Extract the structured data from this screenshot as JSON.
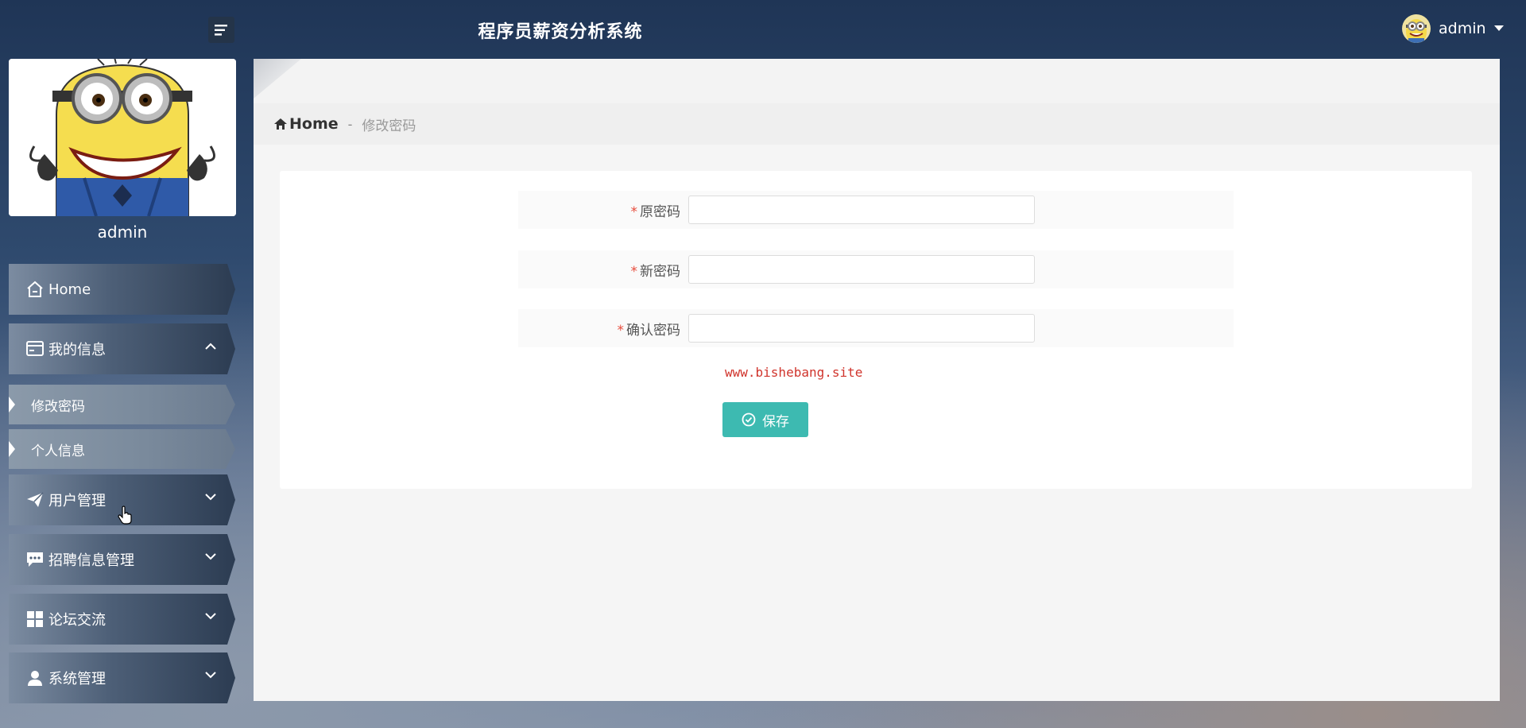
{
  "header": {
    "title": "程序员薪资分析系统",
    "username": "admin",
    "menu_toggle_icon": "hamburger-icon",
    "caret_icon": "caret-down-icon"
  },
  "profile": {
    "name": "admin",
    "image": "minion-avatar"
  },
  "sidebar": {
    "items": [
      {
        "label": "Home",
        "icon": "home-icon"
      },
      {
        "label": "我的信息",
        "icon": "id-card-icon",
        "expanded": true,
        "children": [
          {
            "label": "修改密码",
            "active": true
          },
          {
            "label": "个人信息"
          }
        ]
      },
      {
        "label": "用户管理",
        "icon": "paper-plane-icon"
      },
      {
        "label": "招聘信息管理",
        "icon": "comment-icon"
      },
      {
        "label": "论坛交流",
        "icon": "grid-icon"
      },
      {
        "label": "系统管理",
        "icon": "user-icon"
      }
    ]
  },
  "breadcrumb": {
    "home": "Home",
    "separator": "-",
    "current": "修改密码"
  },
  "form": {
    "required_mark": "*",
    "fields": [
      {
        "label": "原密码",
        "value": ""
      },
      {
        "label": "新密码",
        "value": ""
      },
      {
        "label": "确认密码",
        "value": ""
      }
    ],
    "watermark": "www.bishebang.site",
    "save_label": "保存"
  },
  "colors": {
    "accent": "#3dbab1",
    "required": "#e74c3c",
    "watermark": "#d0342c"
  }
}
